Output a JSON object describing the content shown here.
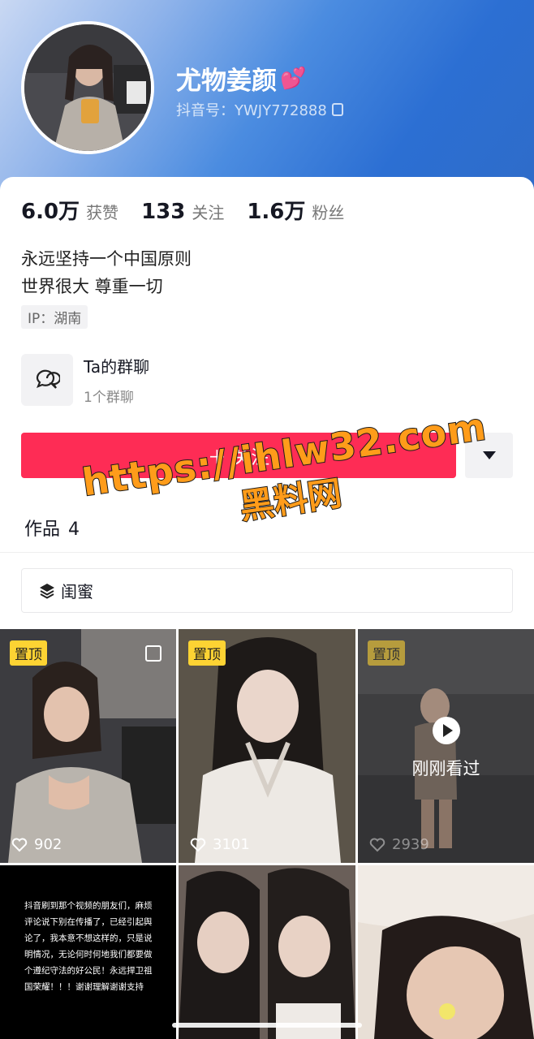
{
  "profile": {
    "nickname": "尤物姜颜",
    "nickname_emoji": "💕",
    "douyin_id": "抖音号：YWJY772888",
    "stats": [
      {
        "value": "6.0万",
        "label": "获赞"
      },
      {
        "value": "133",
        "label": "关注"
      },
      {
        "value": "1.6万",
        "label": "粉丝"
      }
    ],
    "bio_lines": [
      "永远坚持一个中国原则",
      "世界很大 尊重一切"
    ],
    "ip": "IP：湖南"
  },
  "group_chat": {
    "title": "Ta的群聊",
    "subtitle": "1个群聊"
  },
  "actions": {
    "follow_label": "＋ 关注"
  },
  "tabs": {
    "works_label": "作品",
    "works_count": "4"
  },
  "collection": {
    "label": "闺蜜"
  },
  "videos": [
    {
      "pinned": "置顶",
      "likes": "902"
    },
    {
      "pinned": "置顶",
      "likes": "3101"
    },
    {
      "pinned": "置顶",
      "likes": "2939",
      "status": "刚刚看过"
    },
    {
      "text": "抖音刷到那个视频的朋友们，麻烦评论说下别在传播了，已经引起舆论了，我本意不想这样的，只是说明情况，无论何时何地我们都要做个遵纪守法的好公民！永远捍卫祖国荣耀！！！谢谢理解谢谢支持"
    },
    {},
    {}
  ],
  "watermark": {
    "url": "https://ihlw32.com",
    "text": "黑料网"
  },
  "colors": {
    "accent": "#fe2c55",
    "pin": "#fdd333",
    "header_blue": "#2c6fd3"
  }
}
